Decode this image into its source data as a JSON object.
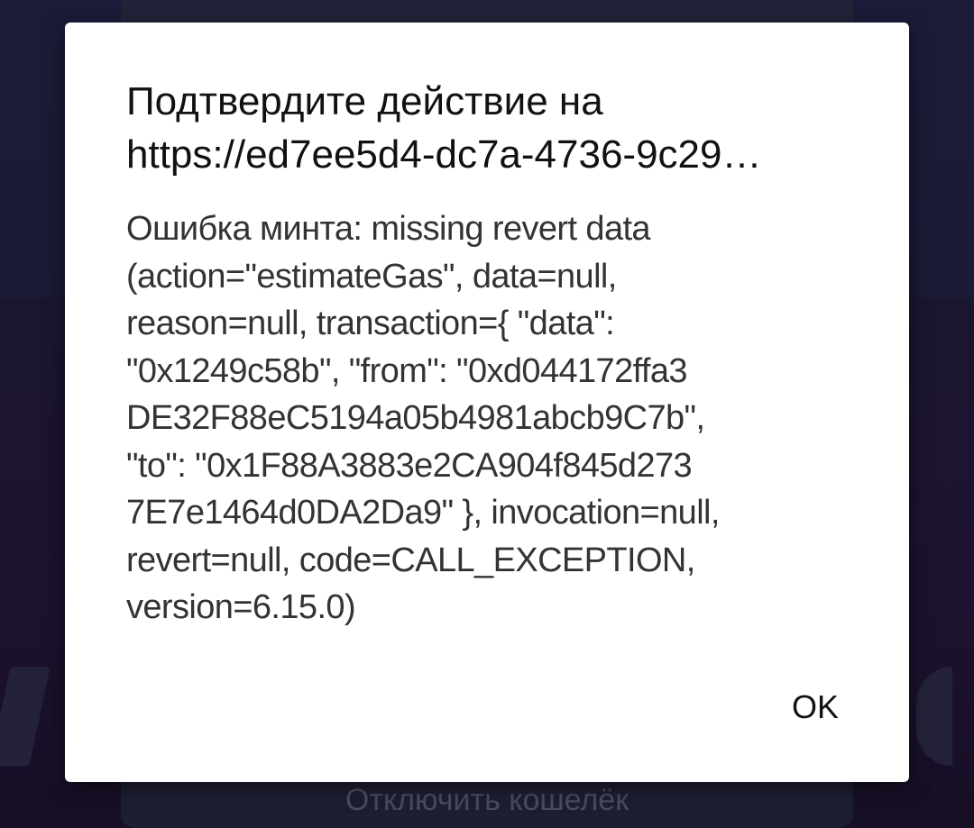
{
  "background": {
    "disconnect_label": "Отключить кошелёк"
  },
  "dialog": {
    "title": "Подтвердите действие на\nhttps://ed7ee5d4-dc7a-4736-9c29…",
    "message": "Ошибка минта: missing revert data\n(action=\"estimateGas\", data=null,\nreason=null, transaction={ \"data\":\n\"0x1249c58b\", \"from\": \"0xd044172ffa3\nDE32F88eC5194a05b4981abcb9C7b\",\n\"to\": \"0x1F88A3883e2CA904f845d273\n7E7e1464d0DA2Da9\" }, invocation=null,\nrevert=null, code=CALL_EXCEPTION,\nversion=6.15.0)",
    "ok_label": "OK"
  }
}
